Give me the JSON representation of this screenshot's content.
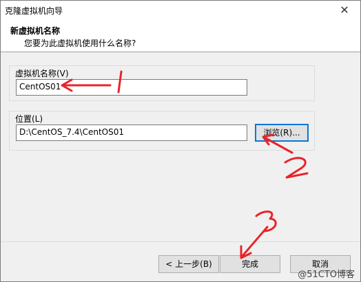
{
  "window": {
    "title": "克隆虚拟机向导",
    "close_glyph": "✕"
  },
  "header": {
    "title": "新虚拟机名称",
    "subtitle": "您要为此虚拟机使用什么名称?"
  },
  "vm_name": {
    "label": "虚拟机名称(V)",
    "value": "CentOS01"
  },
  "location": {
    "label": "位置(L)",
    "value": "D:\\CentOS_7.4\\CentOS01",
    "browse_label": "浏览(R)..."
  },
  "buttons": {
    "back": "< 上一步(B)",
    "finish": "完成",
    "cancel": "取消"
  },
  "watermark": "@51CTO博客",
  "annotation_color": "#e8232a"
}
